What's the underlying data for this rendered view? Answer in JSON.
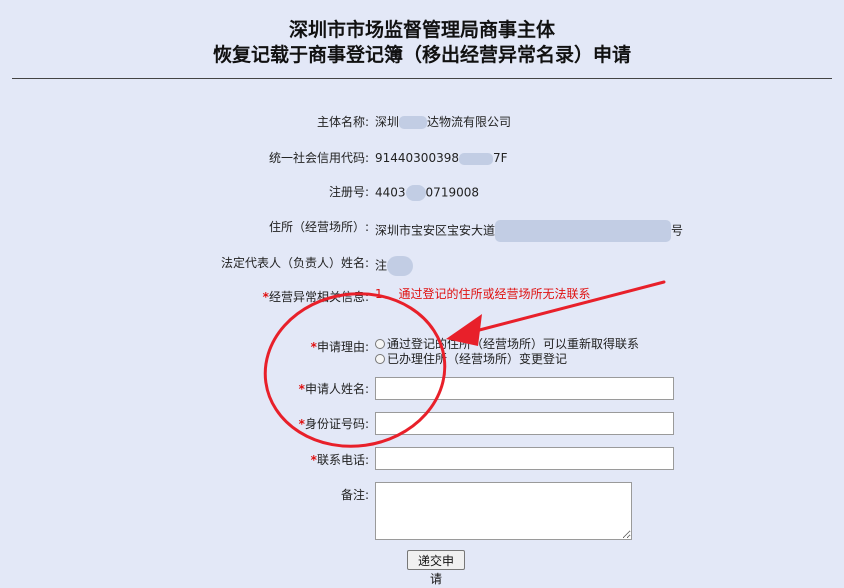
{
  "header": {
    "title_line1": "深圳市市场监督管理局商事主体",
    "title_line2": "恢复记载于商事登记簿（移出经营异常名录）申请"
  },
  "fields": {
    "name": {
      "label": "主体名称:",
      "value_a": "深圳",
      "value_b": "达物流有限公司"
    },
    "credit_code": {
      "label": "统一社会信用代码:",
      "value_a": "91440300398",
      "value_b": "7F"
    },
    "reg_no": {
      "label": "注册号:",
      "value_a": "4403",
      "value_b": "0719008"
    },
    "address": {
      "label": "住所（经营场所）:",
      "value_a": "深圳市宝安区宝安大道",
      "value_b": "号"
    },
    "legal_rep": {
      "label": "法定代表人（负责人）姓名:",
      "value_a": "注"
    },
    "abnormal_info": {
      "required": "*",
      "label": "经营异常相关信息:",
      "value": "1、  通过登记的住所或经营场所无法联系"
    }
  },
  "form": {
    "reason": {
      "required": "*",
      "label": "申请理由:",
      "options": [
        "通过登记的住所（经营场所）可以重新取得联系",
        "已办理住所（经营场所）变更登记"
      ]
    },
    "applicant_name": {
      "required": "*",
      "label": "申请人姓名:"
    },
    "id_number": {
      "required": "*",
      "label": "身份证号码:"
    },
    "phone": {
      "required": "*",
      "label": "联系电话:"
    },
    "remarks": {
      "label": "备注:"
    },
    "submit_label": "递交申请"
  },
  "colors": {
    "background": "#e3e8f7",
    "required": "#e01010",
    "annotation": "#e8202a"
  }
}
